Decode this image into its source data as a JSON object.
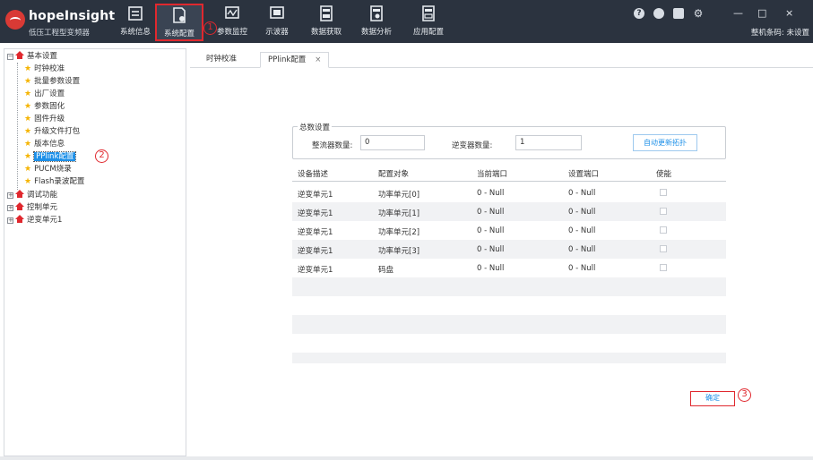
{
  "app": {
    "brand": "hopeInsight",
    "subtitle": "低压工程型变频器",
    "serial_label": "整机条码: 未设置"
  },
  "nav": [
    {
      "label": "系统信息",
      "icon": "system-info-icon"
    },
    {
      "label": "系统配置",
      "icon": "system-config-icon",
      "active": true
    },
    {
      "label": "参数监控",
      "icon": "param-monitor-icon"
    },
    {
      "label": "示波器",
      "icon": "oscilloscope-icon"
    },
    {
      "label": "数据获取",
      "icon": "data-fetch-icon"
    },
    {
      "label": "数据分析",
      "icon": "data-analysis-icon"
    },
    {
      "label": "应用配置",
      "icon": "app-config-icon"
    }
  ],
  "window_controls": {
    "help": "?",
    "minimize": "—",
    "maximize": "□",
    "close": "×"
  },
  "annotations": {
    "one": "1",
    "two": "2",
    "three": "3"
  },
  "tree": {
    "root": "基本设置",
    "children": [
      "时钟校准",
      "批量参数设置",
      "出厂设置",
      "参数固化",
      "固件升级",
      "升级文件打包",
      "版本信息",
      "PPlink配置",
      "PUCM烧录",
      "Flash录波配置"
    ],
    "others": [
      "调试功能",
      "控制单元",
      "逆变单元1"
    ]
  },
  "tabs": [
    {
      "label": "时钟校准"
    },
    {
      "label": "PPlink配置",
      "close": "×"
    }
  ],
  "group": {
    "legend": "总数设置",
    "rectifier_label": "整流器数量:",
    "rectifier_value": "0",
    "inverter_label": "逆变器数量:",
    "inverter_value": "1",
    "auto_button": "自动更新拓扑"
  },
  "table": {
    "headers": [
      "设备描述",
      "配置对象",
      "当前端口",
      "设置端口",
      "使能"
    ],
    "rows": [
      {
        "device": "逆变单元1",
        "object": "功率单元[0]",
        "current": "0 - Null",
        "setting": "0 - Null"
      },
      {
        "device": "逆变单元1",
        "object": "功率单元[1]",
        "current": "0 - Null",
        "setting": "0 - Null"
      },
      {
        "device": "逆变单元1",
        "object": "功率单元[2]",
        "current": "0 - Null",
        "setting": "0 - Null"
      },
      {
        "device": "逆变单元1",
        "object": "功率单元[3]",
        "current": "0 - Null",
        "setting": "0 - Null"
      },
      {
        "device": "逆变单元1",
        "object": "码盘",
        "current": "0 - Null",
        "setting": "0 - Null"
      }
    ]
  },
  "ok_button": "确定"
}
